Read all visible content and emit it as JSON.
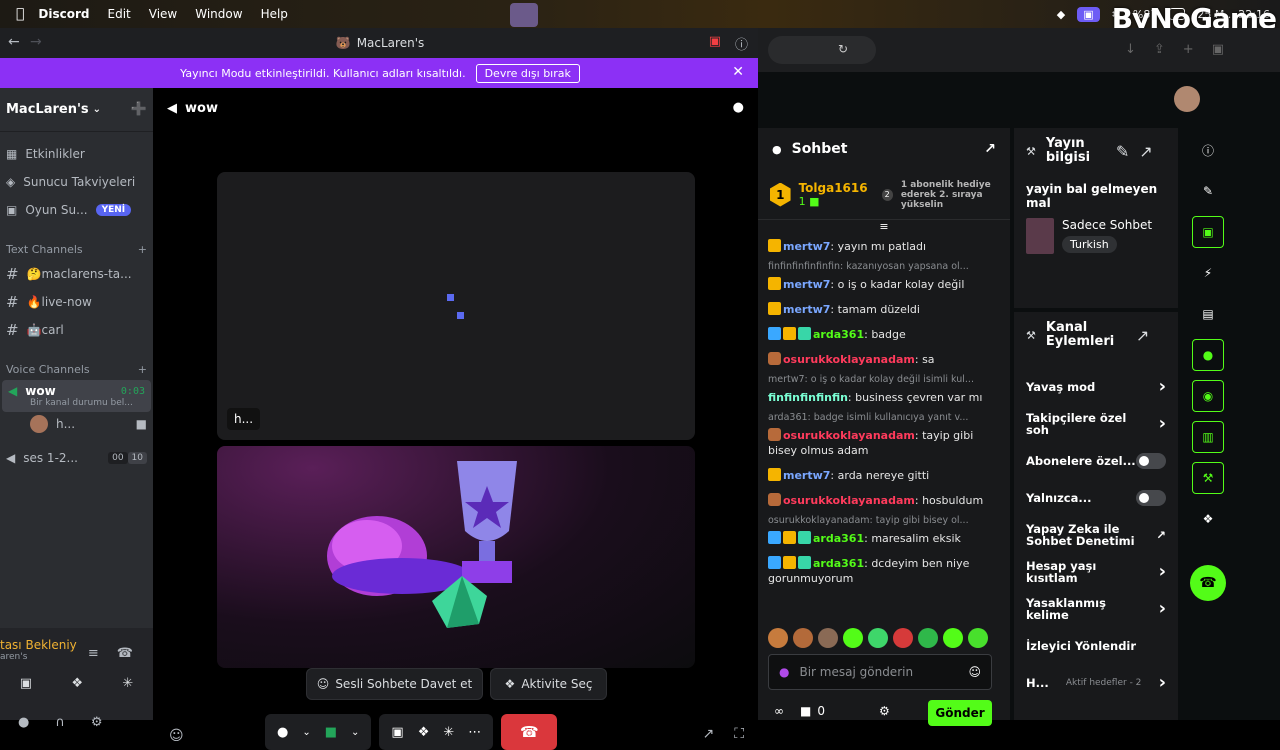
{
  "menubar": {
    "app": "Discord",
    "items": [
      "Edit",
      "View",
      "Window",
      "Help"
    ],
    "battery": "%87",
    "clock": "25 M... 22:16",
    "watermark": "ByNoGame"
  },
  "discord": {
    "window_title": "MacLaren's",
    "banner": {
      "text": "Yayıncı Modu etkinleştirildi. Kullanıcı adları kısaltıldı.",
      "button": "Devre dışı bırak"
    },
    "server_name": "MacLaren's",
    "nav": [
      {
        "label": "Etkinlikler",
        "icon": "calendar-icon"
      },
      {
        "label": "Sunucu Takviyeleri",
        "icon": "boost-icon"
      },
      {
        "label": "Oyun Su...",
        "icon": "gamepad-icon",
        "badge": "YENİ"
      }
    ],
    "text_category": "Text Channels",
    "text_channels": [
      "🤔maclarens-ta...",
      "🔥live-now",
      "🤖carl"
    ],
    "voice_category": "Voice Channels",
    "voice_active": {
      "name": "wow",
      "status": "Bir kanal durumu bel...",
      "timer": "0:03",
      "member": "h..."
    },
    "voice_other": {
      "name": "ses 1-2...",
      "count_a": "00",
      "count_b": "10"
    },
    "voice_header": "wow",
    "tile1_label": "h...",
    "invite_button": "Sesli Sohbete Davet et",
    "activity_button": "Aktivite Seç",
    "waiting_text": "tası Bekleniy",
    "waiting_sub": "aren's"
  },
  "kick": {
    "chat_title": "Sohbet",
    "top_gifter": {
      "name": "Tolga1616",
      "level": "1",
      "count": "1",
      "note": "1 abonelik hediye ederek 2. sıraya yükselin",
      "rank": "2"
    },
    "messages": [
      {
        "type": "msg",
        "badges": [
          "crown"
        ],
        "user": "mertw7",
        "color": "#7aa7ff",
        "text": "yayın mı patladı"
      },
      {
        "type": "reply",
        "text": "finfinfinfinfinfin: kazanıyosan yapsana ol..."
      },
      {
        "type": "msg",
        "badges": [
          "crown"
        ],
        "user": "mertw7",
        "color": "#7aa7ff",
        "text": "o iş o kadar kolay değil"
      },
      {
        "type": "msg",
        "badges": [
          "crown"
        ],
        "user": "mertw7",
        "color": "#7aa7ff",
        "text": "tamam düzeldi"
      },
      {
        "type": "msg",
        "badges": [
          "sword",
          "crown",
          "sub"
        ],
        "user": "arda361",
        "color": "#53fc18",
        "text": "badge"
      },
      {
        "type": "msg",
        "badges": [
          "av"
        ],
        "user": "osurukkoklayanadam",
        "color": "#ff3b5c",
        "text": "sa"
      },
      {
        "type": "reply",
        "text": "mertw7: o iş o kadar kolay değil isimli kul..."
      },
      {
        "type": "msg",
        "badges": [],
        "user": "finfinfinfinfin",
        "color": "#7affd4",
        "text": "business çevren var mı"
      },
      {
        "type": "reply",
        "text": "arda361: badge isimli kullanıcıya yanıt v..."
      },
      {
        "type": "msg",
        "badges": [
          "av"
        ],
        "user": "osurukkoklayanadam",
        "color": "#ff3b5c",
        "text": "tayip gibi bisey olmus adam"
      },
      {
        "type": "msg",
        "badges": [
          "crown"
        ],
        "user": "mertw7",
        "color": "#7aa7ff",
        "text": "arda nereye gitti"
      },
      {
        "type": "msg",
        "badges": [
          "av"
        ],
        "user": "osurukkoklayanadam",
        "color": "#ff3b5c",
        "text": "hosbuldum"
      },
      {
        "type": "reply",
        "text": "osurukkoklayanadam: tayip gibi bisey ol..."
      },
      {
        "type": "msg",
        "badges": [
          "sword",
          "crown",
          "sub"
        ],
        "user": "arda361",
        "color": "#53fc18",
        "text": "maresalim eksik"
      },
      {
        "type": "msg",
        "badges": [
          "sword",
          "crown",
          "sub"
        ],
        "user": "arda361",
        "color": "#53fc18",
        "text": "dcdeyim ben niye gorunmuyorum"
      }
    ],
    "composer_placeholder": "Bir mesaj gönderin",
    "send_label": "Gönder",
    "footer_count": "0",
    "stream_info": {
      "title": "Yayın bilgisi",
      "stream_title": "yayin bal gelmeyen mal",
      "category": "Sadece Sohbet",
      "language": "Turkish"
    },
    "channel_actions": {
      "title": "Kanal Eylemleri",
      "rows": [
        {
          "label": "Yavaş mod",
          "ctrl": "chevron"
        },
        {
          "label": "Takipçilere özel soh",
          "ctrl": "chevron"
        },
        {
          "label": "Abonelere özel...",
          "ctrl": "toggle"
        },
        {
          "label": "Yalnızca...",
          "ctrl": "toggle"
        },
        {
          "label": "Yapay Zeka ile Sohbet Denetimi",
          "ctrl": "external"
        },
        {
          "label": "Hesap yaşı kısıtlam",
          "ctrl": "chevron"
        },
        {
          "label": "Yasaklanmış kelime",
          "ctrl": "chevron"
        },
        {
          "label": "İzleyici Yönlendir",
          "ctrl": "none"
        },
        {
          "label": "H...",
          "ctrl": "chevron",
          "extra": "Aktif hedefler - 2"
        }
      ]
    },
    "colors": {
      "accent": "#53fc18",
      "discord_purple": "#8c30f5",
      "hangup": "#da373c"
    }
  }
}
